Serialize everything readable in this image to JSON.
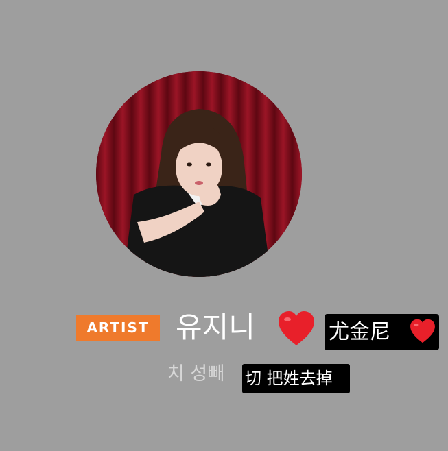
{
  "profile": {
    "avatar_icon": "artist-avatar-photo",
    "badge_label": "ARTIST",
    "badge_color": "#ef7a2c",
    "display_name": "유지니",
    "heart_icon": "red-heart-emoji",
    "sub_name": "치 성빼"
  },
  "captions": {
    "name_caption": "尤金尼",
    "name_caption_heart_icon": "red-heart-emoji",
    "note_caption": "切 把姓去掉"
  },
  "colors": {
    "background": "#9e9e9e",
    "heart": "#e8202a",
    "caption_bg": "#000000"
  }
}
